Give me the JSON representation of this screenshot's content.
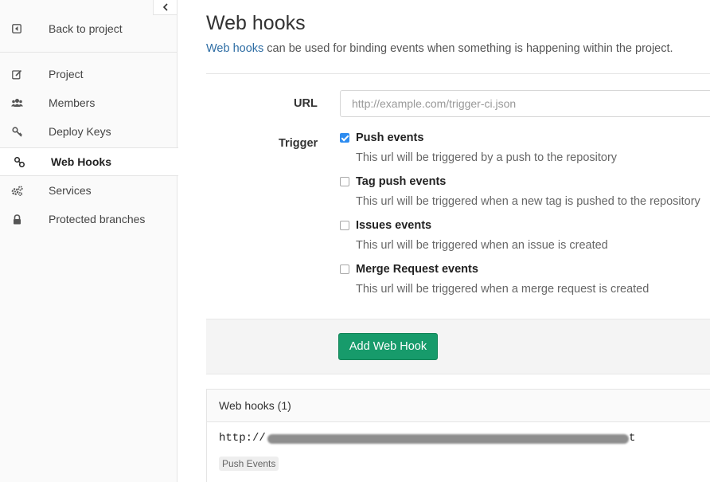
{
  "sidebar": {
    "back_label": "Back to project",
    "items": [
      {
        "label": "Project"
      },
      {
        "label": "Members"
      },
      {
        "label": "Deploy Keys"
      },
      {
        "label": "Web Hooks"
      },
      {
        "label": "Services"
      },
      {
        "label": "Protected branches"
      }
    ]
  },
  "page": {
    "title": "Web hooks",
    "intro_link": "Web hooks",
    "intro_text": " can be used for binding events when something is happening within the project."
  },
  "form": {
    "url_label": "URL",
    "url_placeholder": "http://example.com/trigger-ci.json",
    "trigger_label": "Trigger",
    "triggers": [
      {
        "title": "Push events",
        "desc": "This url will be triggered by a push to the repository",
        "checked": true
      },
      {
        "title": "Tag push events",
        "desc": "This url will be triggered when a new tag is pushed to the repository",
        "checked": false
      },
      {
        "title": "Issues events",
        "desc": "This url will be triggered when an issue is created",
        "checked": false
      },
      {
        "title": "Merge Request events",
        "desc": "This url will be triggered when a merge request is created",
        "checked": false
      }
    ],
    "submit_label": "Add Web Hook"
  },
  "hooks_panel": {
    "title": "Web hooks (1)",
    "hook_url_prefix": "http://",
    "hook_url_suffix": "t",
    "hook_badge": "Push Events"
  },
  "colors": {
    "accent_button": "#179b6b",
    "link": "#2e6da4",
    "checkbox_checked": "#2d8cf0"
  }
}
